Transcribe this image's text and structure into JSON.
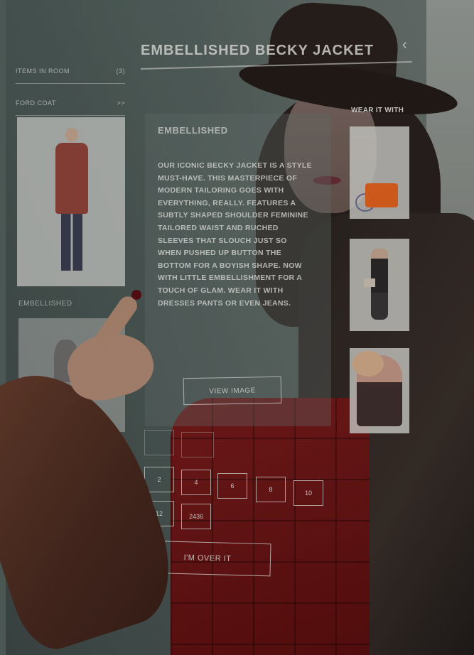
{
  "screen": {
    "title": "EMBELLISHED BECKY JACKET",
    "back_icon": "chevron-left-icon"
  },
  "sidebar": {
    "rows": [
      {
        "label": "ITEMS IN ROOM",
        "count": "(3)"
      },
      {
        "label": "FORD COAT",
        "count": ">>"
      }
    ],
    "section_label": "EMBELLISHED"
  },
  "description": {
    "heading": "EMBELLISHED",
    "body": "OUR ICONIC BECKY JACKET IS A STYLE MUST-HAVE. THIS MASTERPIECE OF MODERN TAILORING GOES WITH EVERYTHING, REALLY. FEATURES A SUBTLY SHAPED SHOULDER FEMININE TAILORED WAIST AND RUCHED SLEEVES THAT SLOUCH JUST SO WHEN PUSHED UP BUTTON THE BOTTOM FOR A BOYISH SHAPE. NOW WITH LITTLE EMBELLISHMENT FOR A TOUCH OF GLAM. WEAR IT WITH DRESSES PANTS OR EVEN JEANS.",
    "view_image_label": "VIEW IMAGE"
  },
  "wear_it_with": {
    "label": "WEAR IT WITH"
  },
  "sizes": {
    "row1": [
      "",
      ""
    ],
    "row2": [
      "2",
      "4",
      "6",
      "8",
      "10"
    ],
    "row3": [
      "12",
      "2436"
    ]
  },
  "actions": {
    "over_it_label": "I'M OVER IT"
  }
}
